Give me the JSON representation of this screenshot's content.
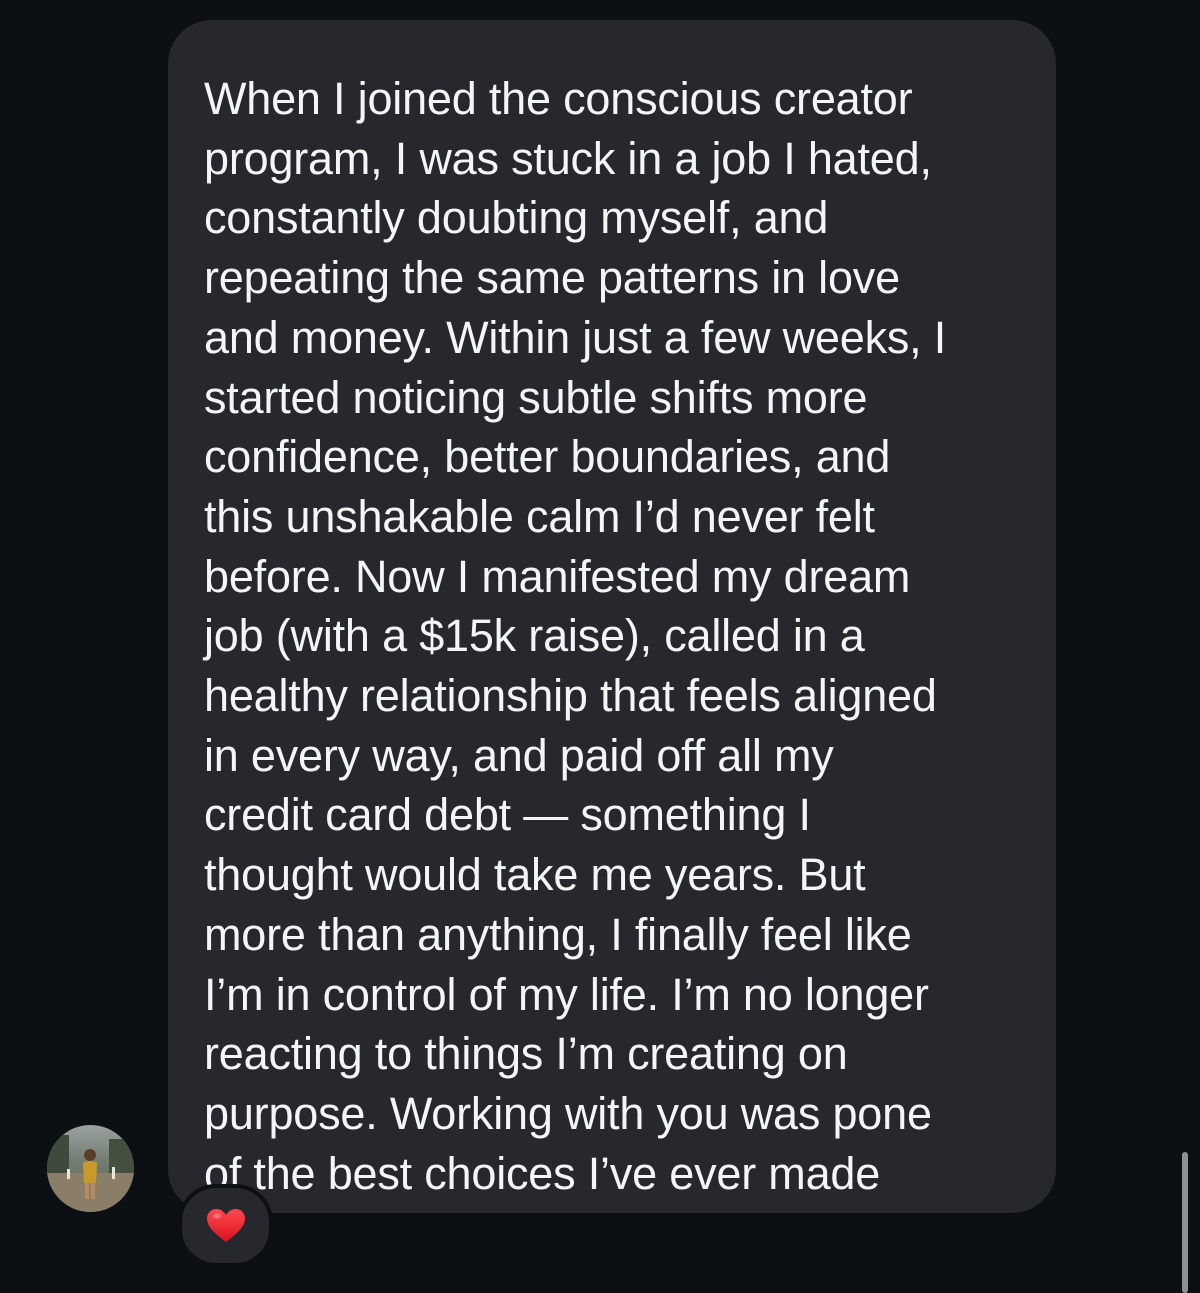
{
  "conversation": {
    "message": {
      "text": "When I joined the conscious creator\nprogram, I was stuck in a job I hated,\nconstantly doubting myself, and\nrepeating the same patterns in love\nand money. Within just a few weeks, I\nstarted noticing subtle shifts more\nconfidence, better boundaries, and\nthis unshakable calm I’d never felt\nbefore. Now I manifested my dream\njob (with a $15k raise), called in a\nhealthy relationship that feels aligned\nin every way, and paid off all my\ncredit card debt — something I\nthought would take me years. But\nmore than anything, I finally feel like\nI’m in control of my life. I’m no longer\nreacting to things I’m creating on\npurpose. Working with you was pone\nof the best choices I’ve ever made",
      "reaction": "heart-icon"
    },
    "sender": {
      "avatar": "profile-photo"
    }
  },
  "colors": {
    "background": "#0c0f14",
    "bubble": "#26282d",
    "text": "#f5f5f7",
    "heart": "#e8192c"
  }
}
